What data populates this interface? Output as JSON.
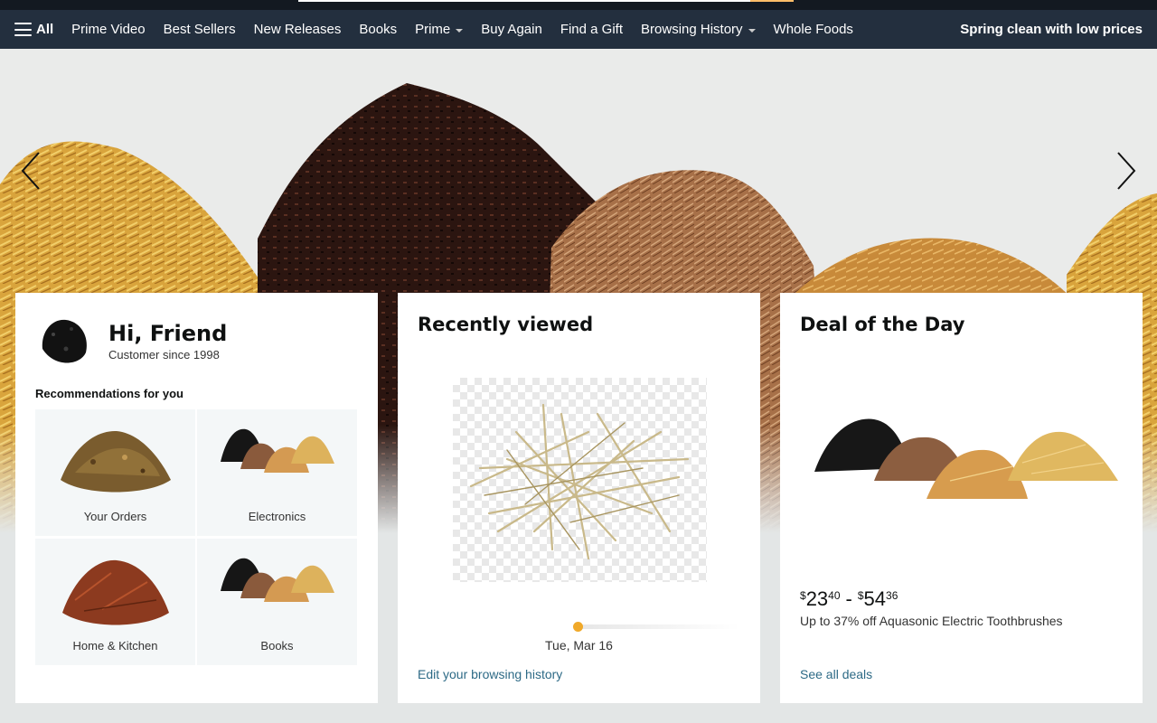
{
  "nav": {
    "all_label": "All",
    "items": [
      {
        "label": "Prime Video",
        "has_caret": false
      },
      {
        "label": "Best Sellers",
        "has_caret": false
      },
      {
        "label": "New Releases",
        "has_caret": false
      },
      {
        "label": "Books",
        "has_caret": false
      },
      {
        "label": "Prime",
        "has_caret": true
      },
      {
        "label": "Buy Again",
        "has_caret": false
      },
      {
        "label": "Find a Gift",
        "has_caret": false
      },
      {
        "label": "Browsing History",
        "has_caret": true
      },
      {
        "label": "Whole Foods",
        "has_caret": false
      }
    ],
    "promo": "Spring clean with low prices"
  },
  "hero": {
    "prev_icon": "chevron-left-icon",
    "next_icon": "chevron-right-icon"
  },
  "greeting_card": {
    "hi": "Hi,",
    "name": "Friend",
    "since": "Customer since 1998",
    "rec_title": "Recommendations for you",
    "tiles": [
      {
        "label": "Your Orders"
      },
      {
        "label": "Electronics"
      },
      {
        "label": "Home & Kitchen"
      },
      {
        "label": "Books"
      }
    ]
  },
  "recent_card": {
    "title": "Recently viewed",
    "date": "Tue, Mar 16",
    "link": "Edit your browsing history"
  },
  "deal_card": {
    "title": "Deal of the Day",
    "price_low_dollars": "23",
    "price_low_cents": "40",
    "price_high_dollars": "54",
    "price_high_cents": "36",
    "currency": "$",
    "dash": "-",
    "description": "Up to 37% off Aquasonic Electric Toothbrushes",
    "link": "See all deals"
  },
  "colors": {
    "nav_bg": "#232f3e",
    "top_bg": "#131921",
    "link": "#2d6a86",
    "accent": "#f0a92a"
  }
}
